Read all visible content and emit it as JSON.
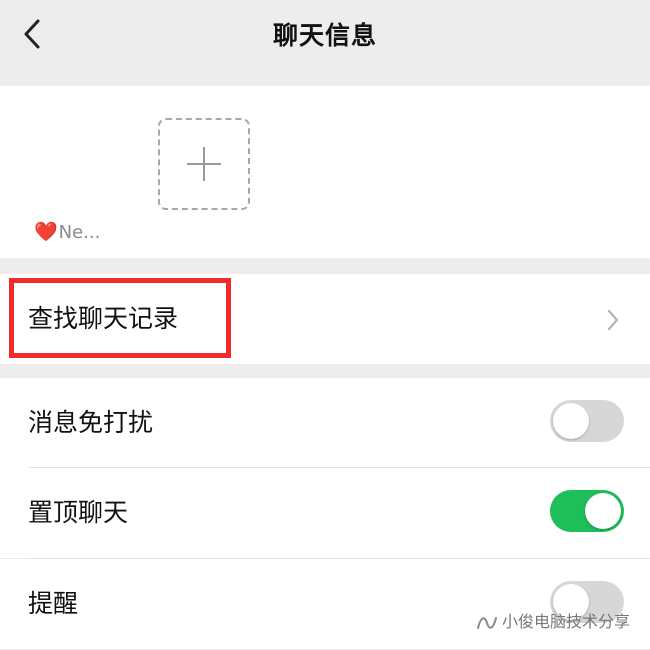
{
  "header": {
    "title": "聊天信息",
    "back_icon": "chevron-left-icon"
  },
  "members": {
    "items": [
      {
        "name": "Ne...",
        "emoji": "❤️"
      }
    ],
    "add_icon": "plus-icon"
  },
  "search_history": {
    "label": "查找聊天记录",
    "chevron_icon": "chevron-right-icon",
    "highlight_color": "#f22b2b"
  },
  "settings": [
    {
      "label": "消息免打扰",
      "enabled": false
    },
    {
      "label": "置顶聊天",
      "enabled": true
    },
    {
      "label": "提醒",
      "enabled": false
    }
  ],
  "colors": {
    "accent_green": "#1ebe5a",
    "toggle_off": "#d7d7d7",
    "background": "#ededed"
  },
  "watermark": {
    "text": "小俊电脑技术分享",
    "icon": "wechat-channel-icon"
  }
}
